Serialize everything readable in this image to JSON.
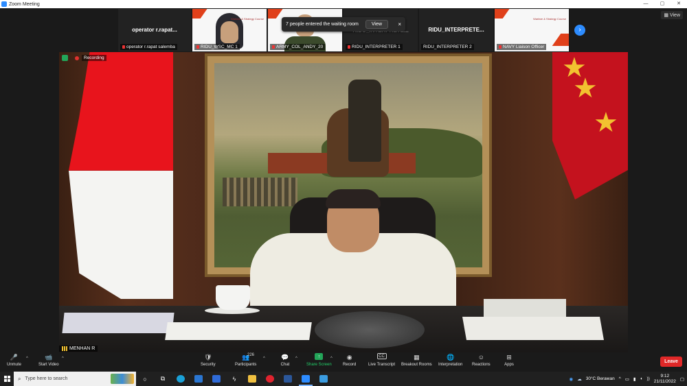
{
  "window": {
    "title": "Zoom Meeting",
    "controls": [
      "—",
      "▢",
      "✕"
    ]
  },
  "gallery": {
    "tiles": [
      {
        "big_name": "operator r.rapat...",
        "caption": "operator r.rapat salemba",
        "type": "name"
      },
      {
        "caption": "RIDU_WSC_MC 1",
        "type": "video-hijab"
      },
      {
        "caption": "ARMY_COL_ANDY_20",
        "type": "video-uniform"
      },
      {
        "big_name": "RIDU_INTERPRETE...",
        "caption": "RIDU_INTERPRETER 1",
        "type": "name"
      },
      {
        "big_name": "RIDU_INTERPRETE...",
        "caption": "RIDU_INTERPRETER 2",
        "type": "name"
      },
      {
        "caption": "NAVY Liaison Officer",
        "type": "slide"
      }
    ],
    "slide_text": "Warfare & Strategy Course",
    "view_label": "View"
  },
  "toast": {
    "message": "7 people entered the waiting room",
    "view_button": "View",
    "close": "×"
  },
  "main_video": {
    "recording_label": "Recording",
    "speaker_name": "MENHAN R"
  },
  "toolbar": {
    "items": [
      {
        "key": "unmute",
        "label": "Unmute",
        "icon": "🎤"
      },
      {
        "key": "start-video",
        "label": "Start Video",
        "icon": "📹"
      },
      {
        "key": "security",
        "label": "Security",
        "icon": "🛡"
      },
      {
        "key": "participants",
        "label": "Participants",
        "icon": "👥",
        "count": "226"
      },
      {
        "key": "chat",
        "label": "Chat",
        "icon": "💬"
      },
      {
        "key": "share-screen",
        "label": "Share Screen",
        "icon": "↑"
      },
      {
        "key": "record",
        "label": "Record",
        "icon": "◉"
      },
      {
        "key": "live-transcript",
        "label": "Live Transcript",
        "icon": "CC"
      },
      {
        "key": "breakout-rooms",
        "label": "Breakout Rooms",
        "icon": "▦"
      },
      {
        "key": "interpretation",
        "label": "Interpretation",
        "icon": "🌐"
      },
      {
        "key": "reactions",
        "label": "Reactions",
        "icon": "☺"
      },
      {
        "key": "apps",
        "label": "Apps",
        "icon": "⊞"
      }
    ],
    "leave_label": "Leave"
  },
  "taskbar": {
    "search_placeholder": "Type here to search",
    "weather": "30°C  Berawan",
    "time": "9:12",
    "date": "21/11/2022"
  },
  "colors": {
    "zoom_blue": "#2d8cff",
    "leave_red": "#e02828",
    "share_green": "#23a559",
    "recording_red": "#e0322f"
  }
}
